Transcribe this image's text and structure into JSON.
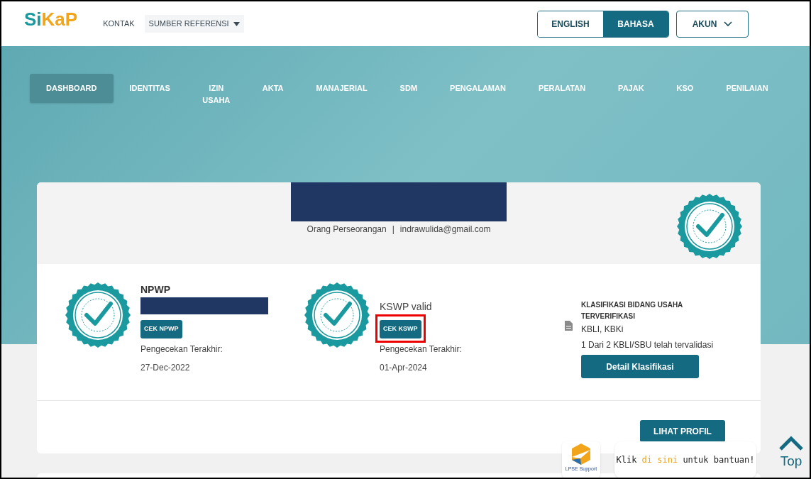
{
  "header": {
    "logo": {
      "part1": "Si",
      "part2": "KaP"
    },
    "links": [
      {
        "label": "KONTAK",
        "dropdown": false
      },
      {
        "label": "SUMBER REFERENSI",
        "dropdown": true
      }
    ],
    "languages": [
      {
        "label": "ENGLISH",
        "selected": false
      },
      {
        "label": "BAHASA",
        "selected": true
      }
    ],
    "account": "AKUN"
  },
  "nav": [
    {
      "label": "DASHBOARD",
      "selected": true
    },
    {
      "label": "IDENTITAS",
      "selected": false
    },
    {
      "label": "IZIN USAHA",
      "selected": false
    },
    {
      "label": "AKTA",
      "selected": false
    },
    {
      "label": "MANAJERIAL",
      "selected": false
    },
    {
      "label": "SDM",
      "selected": false
    },
    {
      "label": "PENGALAMAN",
      "selected": false
    },
    {
      "label": "PERALATAN",
      "selected": false
    },
    {
      "label": "PAJAK",
      "selected": false
    },
    {
      "label": "KSO",
      "selected": false
    },
    {
      "label": "PENILAIAN",
      "selected": false
    }
  ],
  "profile": {
    "type": "Orang Perseorangan",
    "separator": "|",
    "email": "indrawulida@gmail.com"
  },
  "checks": [
    {
      "title": "NPWP",
      "button": "CEK NPWP",
      "highlighted": false,
      "last_label": "Pengecekan Terakhir:",
      "last_date": "27-Dec-2022"
    },
    {
      "title": "KSWP valid",
      "button": "CEK KSWP",
      "highlighted": true,
      "last_label": "Pengecekan Terakhir:",
      "last_date": "01-Apr-2024"
    }
  ],
  "classification": {
    "title": "KLASIFIKASI BIDANG USAHA TERVERIFIKASI",
    "codes": "KBLI, KBKi",
    "status": "1 Dari 2 KBLI/SBU telah tervalidasi",
    "button": "Detail Klasifikasi"
  },
  "profile_button": "LIHAT PROFIL",
  "support": {
    "logo_label": "LPSE Support",
    "prefix": "Klik",
    "link": "di sini",
    "suffix": "untuk bantuan!"
  },
  "top_button": "Top"
}
